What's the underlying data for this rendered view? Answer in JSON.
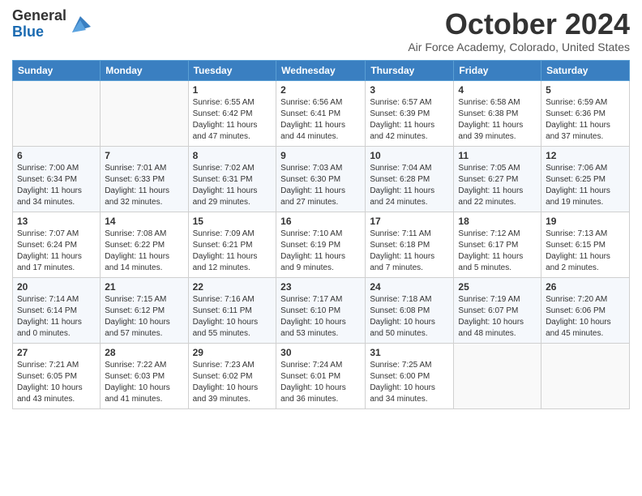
{
  "header": {
    "logo_line1": "General",
    "logo_line2": "Blue",
    "month_title": "October 2024",
    "subtitle": "Air Force Academy, Colorado, United States"
  },
  "weekdays": [
    "Sunday",
    "Monday",
    "Tuesday",
    "Wednesday",
    "Thursday",
    "Friday",
    "Saturday"
  ],
  "weeks": [
    [
      {
        "day": "",
        "info": ""
      },
      {
        "day": "",
        "info": ""
      },
      {
        "day": "1",
        "info": "Sunrise: 6:55 AM\nSunset: 6:42 PM\nDaylight: 11 hours and 47 minutes."
      },
      {
        "day": "2",
        "info": "Sunrise: 6:56 AM\nSunset: 6:41 PM\nDaylight: 11 hours and 44 minutes."
      },
      {
        "day": "3",
        "info": "Sunrise: 6:57 AM\nSunset: 6:39 PM\nDaylight: 11 hours and 42 minutes."
      },
      {
        "day": "4",
        "info": "Sunrise: 6:58 AM\nSunset: 6:38 PM\nDaylight: 11 hours and 39 minutes."
      },
      {
        "day": "5",
        "info": "Sunrise: 6:59 AM\nSunset: 6:36 PM\nDaylight: 11 hours and 37 minutes."
      }
    ],
    [
      {
        "day": "6",
        "info": "Sunrise: 7:00 AM\nSunset: 6:34 PM\nDaylight: 11 hours and 34 minutes."
      },
      {
        "day": "7",
        "info": "Sunrise: 7:01 AM\nSunset: 6:33 PM\nDaylight: 11 hours and 32 minutes."
      },
      {
        "day": "8",
        "info": "Sunrise: 7:02 AM\nSunset: 6:31 PM\nDaylight: 11 hours and 29 minutes."
      },
      {
        "day": "9",
        "info": "Sunrise: 7:03 AM\nSunset: 6:30 PM\nDaylight: 11 hours and 27 minutes."
      },
      {
        "day": "10",
        "info": "Sunrise: 7:04 AM\nSunset: 6:28 PM\nDaylight: 11 hours and 24 minutes."
      },
      {
        "day": "11",
        "info": "Sunrise: 7:05 AM\nSunset: 6:27 PM\nDaylight: 11 hours and 22 minutes."
      },
      {
        "day": "12",
        "info": "Sunrise: 7:06 AM\nSunset: 6:25 PM\nDaylight: 11 hours and 19 minutes."
      }
    ],
    [
      {
        "day": "13",
        "info": "Sunrise: 7:07 AM\nSunset: 6:24 PM\nDaylight: 11 hours and 17 minutes."
      },
      {
        "day": "14",
        "info": "Sunrise: 7:08 AM\nSunset: 6:22 PM\nDaylight: 11 hours and 14 minutes."
      },
      {
        "day": "15",
        "info": "Sunrise: 7:09 AM\nSunset: 6:21 PM\nDaylight: 11 hours and 12 minutes."
      },
      {
        "day": "16",
        "info": "Sunrise: 7:10 AM\nSunset: 6:19 PM\nDaylight: 11 hours and 9 minutes."
      },
      {
        "day": "17",
        "info": "Sunrise: 7:11 AM\nSunset: 6:18 PM\nDaylight: 11 hours and 7 minutes."
      },
      {
        "day": "18",
        "info": "Sunrise: 7:12 AM\nSunset: 6:17 PM\nDaylight: 11 hours and 5 minutes."
      },
      {
        "day": "19",
        "info": "Sunrise: 7:13 AM\nSunset: 6:15 PM\nDaylight: 11 hours and 2 minutes."
      }
    ],
    [
      {
        "day": "20",
        "info": "Sunrise: 7:14 AM\nSunset: 6:14 PM\nDaylight: 11 hours and 0 minutes."
      },
      {
        "day": "21",
        "info": "Sunrise: 7:15 AM\nSunset: 6:12 PM\nDaylight: 10 hours and 57 minutes."
      },
      {
        "day": "22",
        "info": "Sunrise: 7:16 AM\nSunset: 6:11 PM\nDaylight: 10 hours and 55 minutes."
      },
      {
        "day": "23",
        "info": "Sunrise: 7:17 AM\nSunset: 6:10 PM\nDaylight: 10 hours and 53 minutes."
      },
      {
        "day": "24",
        "info": "Sunrise: 7:18 AM\nSunset: 6:08 PM\nDaylight: 10 hours and 50 minutes."
      },
      {
        "day": "25",
        "info": "Sunrise: 7:19 AM\nSunset: 6:07 PM\nDaylight: 10 hours and 48 minutes."
      },
      {
        "day": "26",
        "info": "Sunrise: 7:20 AM\nSunset: 6:06 PM\nDaylight: 10 hours and 45 minutes."
      }
    ],
    [
      {
        "day": "27",
        "info": "Sunrise: 7:21 AM\nSunset: 6:05 PM\nDaylight: 10 hours and 43 minutes."
      },
      {
        "day": "28",
        "info": "Sunrise: 7:22 AM\nSunset: 6:03 PM\nDaylight: 10 hours and 41 minutes."
      },
      {
        "day": "29",
        "info": "Sunrise: 7:23 AM\nSunset: 6:02 PM\nDaylight: 10 hours and 39 minutes."
      },
      {
        "day": "30",
        "info": "Sunrise: 7:24 AM\nSunset: 6:01 PM\nDaylight: 10 hours and 36 minutes."
      },
      {
        "day": "31",
        "info": "Sunrise: 7:25 AM\nSunset: 6:00 PM\nDaylight: 10 hours and 34 minutes."
      },
      {
        "day": "",
        "info": ""
      },
      {
        "day": "",
        "info": ""
      }
    ]
  ]
}
